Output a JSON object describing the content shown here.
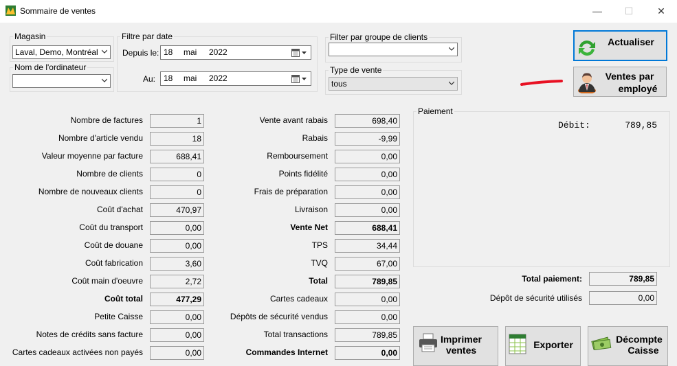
{
  "window": {
    "title": "Sommaire de ventes",
    "minimize_glyph": "—",
    "maximize_glyph": "☐",
    "close_glyph": "✕"
  },
  "filters": {
    "magasin": {
      "label": "Magasin",
      "value": "Laval, Demo, Montréal"
    },
    "ordinateur": {
      "label": "Nom de l'ordinateur",
      "value": ""
    },
    "date": {
      "label": "Filtre par date",
      "from_label": "Depuis le:",
      "from_day": "18",
      "from_month": "mai",
      "from_year": "2022",
      "to_label": "Au:",
      "to_day": "18",
      "to_month": "mai",
      "to_year": "2022"
    },
    "groupe": {
      "label": "Filter par groupe de clients",
      "value": ""
    },
    "type_vente": {
      "label": "Type de vente",
      "value": "tous"
    }
  },
  "buttons": {
    "actualiser": "Actualiser",
    "ventes_employe_line1": "Ventes par",
    "ventes_employe_line2": "employé",
    "imprimer_line1": "Imprimer",
    "imprimer_line2": "ventes",
    "exporter": "Exporter",
    "decompte_line1": "Décompte",
    "decompte_line2": "Caisse"
  },
  "left_stats": [
    {
      "label": "Nombre de factures",
      "value": "1",
      "bold": false
    },
    {
      "label": "Nombre d'article vendu",
      "value": "18",
      "bold": false
    },
    {
      "label": "Valeur moyenne par facture",
      "value": "688,41",
      "bold": false
    },
    {
      "label": "Nombre de clients",
      "value": "0",
      "bold": false
    },
    {
      "label": "Nombre de nouveaux clients",
      "value": "0",
      "bold": false
    },
    {
      "label": "Coût d'achat",
      "value": "470,97",
      "bold": false
    },
    {
      "label": "Coût du transport",
      "value": "0,00",
      "bold": false
    },
    {
      "label": "Coût de douane",
      "value": "0,00",
      "bold": false
    },
    {
      "label": "Coût fabrication",
      "value": "3,60",
      "bold": false
    },
    {
      "label": "Coût main d'oeuvre",
      "value": "2,72",
      "bold": false
    },
    {
      "label": "Coût total",
      "value": "477,29",
      "bold": true
    },
    {
      "label": "Petite Caisse",
      "value": "0,00",
      "bold": false
    },
    {
      "label": "Notes de crédits sans facture",
      "value": "0,00",
      "bold": false
    },
    {
      "label": "Cartes cadeaux activées non payés",
      "value": "0,00",
      "bold": false
    }
  ],
  "middle_stats": [
    {
      "label": "Vente avant rabais",
      "value": "698,40",
      "bold": false
    },
    {
      "label": "Rabais",
      "value": "-9,99",
      "bold": false
    },
    {
      "label": "Remboursement",
      "value": "0,00",
      "bold": false
    },
    {
      "label": "Points fidélité",
      "value": "0,00",
      "bold": false
    },
    {
      "label": "Frais de préparation",
      "value": "0,00",
      "bold": false
    },
    {
      "label": "Livraison",
      "value": "0,00",
      "bold": false
    },
    {
      "label": "Vente Net",
      "value": "688,41",
      "bold": true
    },
    {
      "label": "TPS",
      "value": "34,44",
      "bold": false
    },
    {
      "label": "TVQ",
      "value": "67,00",
      "bold": false
    },
    {
      "label": "Total",
      "value": "789,85",
      "bold": true
    },
    {
      "label": "Cartes cadeaux",
      "value": "0,00",
      "bold": false
    },
    {
      "label": "Dépôts de sécurité vendus",
      "value": "0,00",
      "bold": false
    },
    {
      "label": "Total transactions",
      "value": "789,85",
      "bold": false
    },
    {
      "label": "Commandes Internet",
      "value": "0,00",
      "bold": true
    }
  ],
  "paiement": {
    "label": "Paiement",
    "lines": [
      {
        "label": "Débit:",
        "value": "789,85"
      }
    ],
    "total_label": "Total paiement:",
    "total_value": "789,85",
    "depot_label": "Dépôt de sécurité utilisés",
    "depot_value": "0,00"
  },
  "colors": {
    "accent_focus": "#0078d7",
    "annotation": "#e81123",
    "refresh_green": "#2fa12f"
  }
}
